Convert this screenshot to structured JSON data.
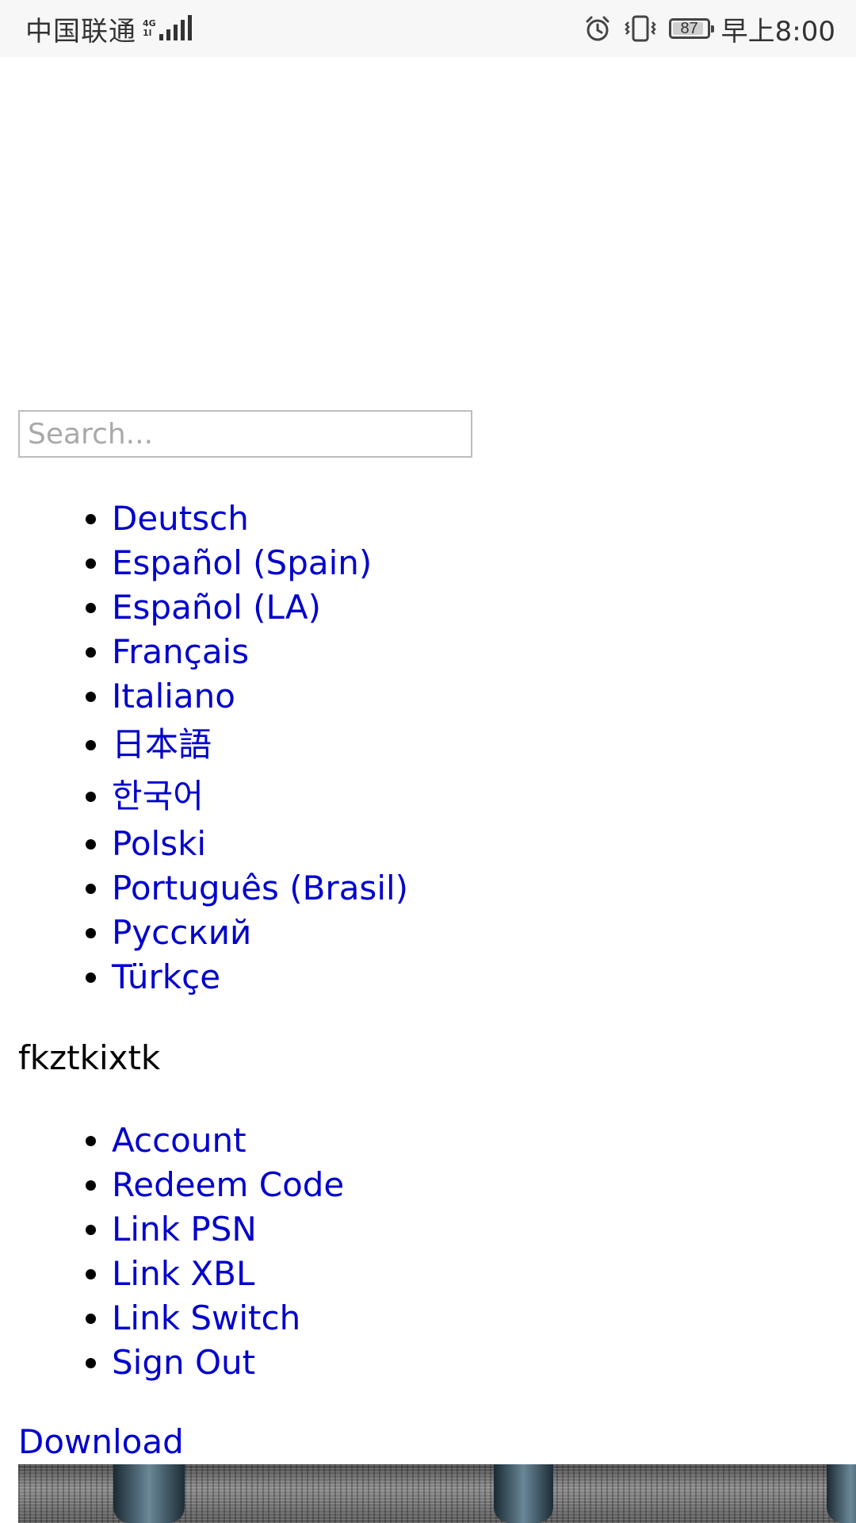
{
  "status_bar": {
    "carrier": "中国联通",
    "network_type": "4G",
    "network_sub": "1l",
    "battery_level": "87",
    "time": "早上8:00",
    "icons": [
      "signal-icon",
      "alarm-icon",
      "vibrate-icon",
      "battery-icon"
    ]
  },
  "search": {
    "placeholder": "Search...",
    "value": ""
  },
  "languages": [
    {
      "label": "Deutsch"
    },
    {
      "label": "Español (Spain)"
    },
    {
      "label": "Español (LA)"
    },
    {
      "label": "Français"
    },
    {
      "label": "Italiano"
    },
    {
      "label": "日本語"
    },
    {
      "label": "한국어"
    },
    {
      "label": "Polski"
    },
    {
      "label": "Português (Brasil)"
    },
    {
      "label": "Русский"
    },
    {
      "label": "Türkçe"
    }
  ],
  "user": {
    "name": "fkztkixtk"
  },
  "account_menu": [
    {
      "label": "Account"
    },
    {
      "label": "Redeem Code"
    },
    {
      "label": "Link PSN"
    },
    {
      "label": "Link XBL"
    },
    {
      "label": "Link Switch"
    },
    {
      "label": "Sign Out"
    }
  ],
  "download": {
    "label": "Download"
  },
  "colors": {
    "link": "#0000cc",
    "text": "#000000",
    "status_bar_bg": "#f7f7f7"
  }
}
